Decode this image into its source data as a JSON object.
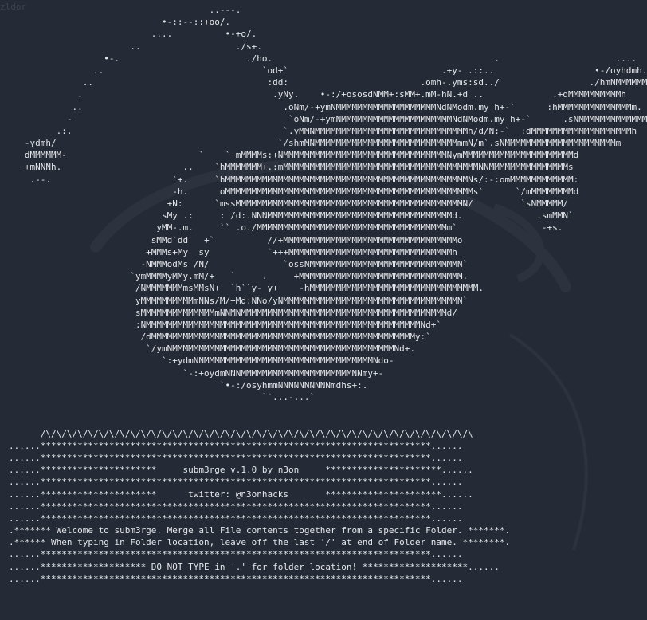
{
  "window": {
    "title": "zldor"
  },
  "terminal": {
    "art": [
      "                                      ..---.",
      "                             •-::--::+oo/.",
      "                           ....          •-+o/.",
      "                       ..                  ./s+.",
      "                  •-.                        ./ho.                                          .                      ....",
      "                ..                              `od+`                             .+y- .::..                   •-/oyhdmh.",
      "              ..                                 :dd:                         .omh-.yms:sd../                 ./hmNMMMMMMN:",
      "             .                                    .yNy.    •-:/+ososdNMM+:sMM+.mM-hN.+d ..             .+dMMMMMMMMMMh",
      "            ..                                      .oNm/-+ymNMMMMMMMMMMMMMMMMMMMNdNModm.my h+-`      :hMMMMMMMMMMMMMMm.",
      "           -                                         `oNm/-+ymNMMMMMMMMMMMMMMMMMMMMMNdNModm.my h+-`      .sNMMMMMMMMMMMMMMMm:",
      "         .:.                                        `.yMMNMMMMMMMMMMMMMMMMMMMMMMMMMMMMMh/d/N:-`  :dMMMMMMMMMMMMMMMMMMMh",
      "   -ydmh/                                          `/shmMNMMMMMMMMMMMMMMMMMMMMMMMMMMMmmN/m`.sNMMMMMMMMMMMMMMMMMMMMMm",
      "   dMMMMMM-                         `    `+mMMMMs:+NMMMMMMMMMMMMMMMMMMMMMMMMMMMMMMMNymMMMMMMMMMMMMMMMMMMMMMd",
      "   +mNNNh.                       ..    `hMMMMMMM+.:mMMMMMMMMMMMMMMMMMMMMMMMMMMMMMMMMMMMMMNNMMMMMMMMMMMMMMMs",
      "    .--.                       `+.     `hMMMMMMMMMMMMMMMMMMMMMMMMMMMMMMMMMMMMMMMMMMMMMMNs/:-:omMMMMMMMMMMMM:",
      "                               -h.      oMMMMMMMMMMMMMMMMMMMMMMMMMMMMMMMMMMMMMMMMMMMMMMMs`      `/mMMMMMMMMd",
      "                              +N:      `mssMMMMMMMMMMMMMMMMMMMMMMMMMMMMMMMMMMMMMMMMMMMN/         `sNMMMMM/",
      "                             sMy .:     : /d:.NNNMMMMMMMMMMMMMMMMMMMMMMMMMMMMMMMMMMMd.              .smMMN`",
      "                            yMM-.m.     `` .o./MMMMMMMMMMMMMMMMMMMMMMMMMMMMMMMMMMMMm`                -+s.",
      "                           sMMd`dd   +`          //+MMMMMMMMMMMMMMMMMMMMMMMMMMMMMMMMMo",
      "                          +MMMs+My  sy           `+++MMMMMMMMMMMMMMMMMMMMMMMMMMMMMMMh",
      "                         -NMMModMs /N/              `ossNMMMMMMMMMMMMMMMMMMMMMMMMMMMMN`",
      "                       `ymMMMMyMMy.mM/+   `     .     +MMMMMMMMMMMMMMMMMMMMMMMMMMMMMMM.",
      "                        /NMMMMMMMmsMMsN+  `h``y- y+    -hMMMMMMMMMMMMMMMMMMMMMMMMMMMMMMMM.",
      "                        yMMMMMMMMMMmNNs/M/+Md:NNo/yNMMMMMMMMMMMMMMMMMMMMMMMMMMMMMMMMMN`",
      "                        sMMMMMMMMMMMMMMmNNMNMMMMMMMMMMMMMMMMMMMMMMMMMMMMMMMMMMMMMMMd/",
      "                        :NMMMMMMMMMMMMMMMMMMMMMMMMMMMMMMMMMMMMMMMMMMMMMMMMMMMMNd+`",
      "                         /dMMMMMMMMMMMMMMMMMMMMMMMMMMMMMMMMMMMMMMMMMMMMMMMMMMy:`",
      "                          `/ymNMMMMMMMMMMMMMMMMMMMMMMMMMMMMMMMMMMMMMMMMMMNd+.",
      "                             `:+ydmNNMMMMMMMMMMMMMMMMMMMMMMMMMMMMMMMMNdo-",
      "                                 `-:+oydmNNNMMMMMMMMMMMMMMMMMMMMMNNmy+-",
      "                                        `•-:/osyhmmNNNNNNNNNNmdhs+:.",
      "                                                ``...-...`"
    ],
    "banner_lines": [
      "",
      "",
      "      /\\/\\/\\/\\/\\/\\/\\/\\/\\/\\/\\/\\/\\/\\/\\/\\/\\/\\/\\/\\/\\/\\/\\/\\/\\/\\/\\/\\/\\/\\/\\/\\/\\/\\/\\/\\/\\/\\/\\/\\/\\",
      "......**************************************************************************......",
      "......**************************************************************************......",
      "......**********************     subm3rge v.1.0 by n3on     **********************......",
      "......**************************************************************************......",
      "......**********************      twitter: @n3onhacks       **********************......",
      "......**************************************************************************......",
      "......**************************************************************************......",
      ".******* Welcome to subm3rge. Merge all File contents together from a specific Folder. *******.",
      ".****** When typing in Folder location, leave off the last '/' at end of Folder name. ********.",
      "......**************************************************************************......",
      "......******************** DO NOT TYPE in '.' for folder location! ********************......",
      "......**************************************************************************......"
    ]
  }
}
